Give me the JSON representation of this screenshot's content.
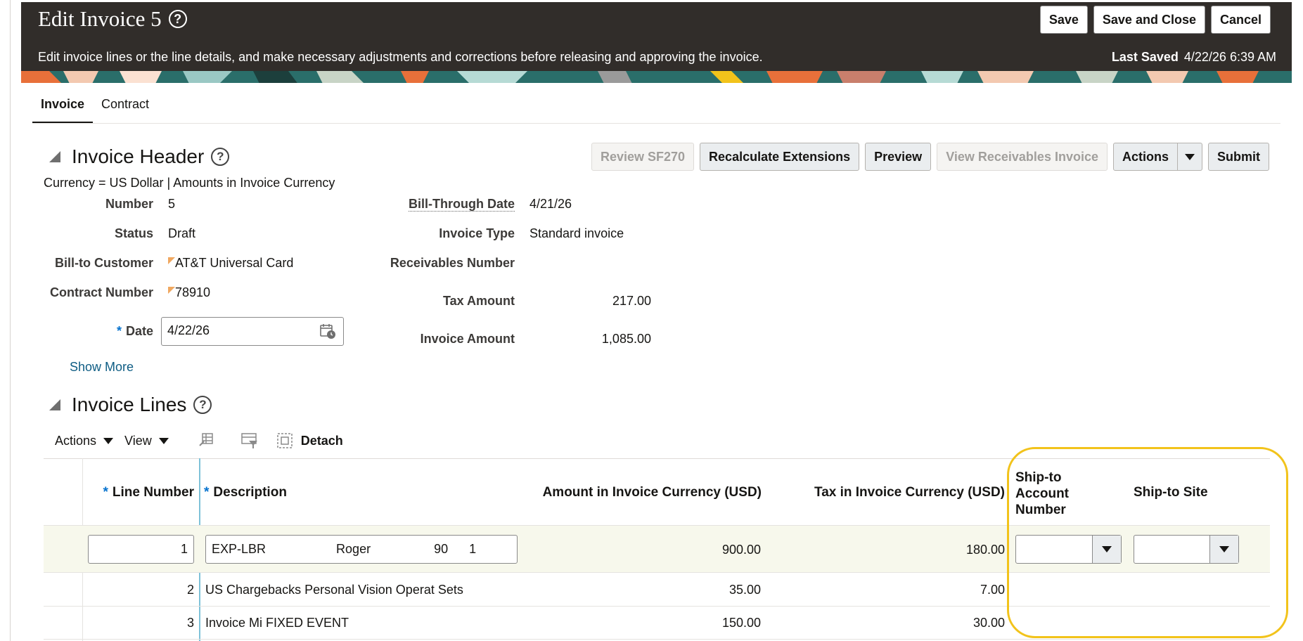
{
  "header": {
    "title": "Edit Invoice 5",
    "subtitle": "Edit invoice lines or the line details, and make necessary adjustments and corrections before releasing and approving the invoice.",
    "last_saved_label": "Last Saved",
    "last_saved_value": "4/22/26 6:39 AM",
    "buttons": {
      "save": "Save",
      "save_and_close": "Save and Close",
      "cancel": "Cancel"
    }
  },
  "tabs": [
    {
      "label": "Invoice",
      "active": true
    },
    {
      "label": "Contract",
      "active": false
    }
  ],
  "invoice_header": {
    "title": "Invoice Header",
    "currency_note": "Currency = US Dollar | Amounts in Invoice Currency",
    "buttons": {
      "review_sf270": "Review SF270",
      "recalculate": "Recalculate Extensions",
      "preview": "Preview",
      "view_receivables": "View Receivables Invoice",
      "actions": "Actions",
      "submit": "Submit"
    },
    "fields": {
      "number_label": "Number",
      "number_value": "5",
      "status_label": "Status",
      "status_value": "Draft",
      "bill_to_label": "Bill-to Customer",
      "bill_to_value": "AT&T Universal Card",
      "contract_label": "Contract Number",
      "contract_value": "78910",
      "date_label": "Date",
      "date_value": "4/22/26",
      "bill_through_label": "Bill-Through Date",
      "bill_through_value": "4/21/26",
      "invoice_type_label": "Invoice Type",
      "invoice_type_value": "Standard invoice",
      "receivables_label": "Receivables Number",
      "tax_label": "Tax Amount",
      "tax_value": "217.00",
      "invoice_amount_label": "Invoice Amount",
      "invoice_amount_value": "1,085.00"
    },
    "show_more": "Show More"
  },
  "invoice_lines": {
    "title": "Invoice Lines",
    "toolbar": {
      "actions": "Actions",
      "view": "View",
      "detach": "Detach"
    },
    "columns": {
      "line_number": "Line Number",
      "description": "Description",
      "amount": "Amount in Invoice Currency (USD)",
      "tax": "Tax in Invoice Currency (USD)",
      "ship_to_account_1": "Ship-to",
      "ship_to_account_2": "Account",
      "ship_to_account_3": "Number",
      "ship_to_site": "Ship-to Site"
    },
    "rows": [
      {
        "line": "1",
        "description": "EXP-LBR                    Roger                  90      1",
        "amount": "900.00",
        "tax": "180.00"
      },
      {
        "line": "2",
        "description": "US Chargebacks Personal Vision Operat Sets",
        "amount": "35.00",
        "tax": "7.00"
      },
      {
        "line": "3",
        "description": "Invoice Mi FIXED EVENT",
        "amount": "150.00",
        "tax": "30.00"
      }
    ]
  },
  "colors": {
    "banner": "#312d2a",
    "highlight": "#f2c31b",
    "link": "#0f5d84",
    "required": "#0572ce"
  }
}
